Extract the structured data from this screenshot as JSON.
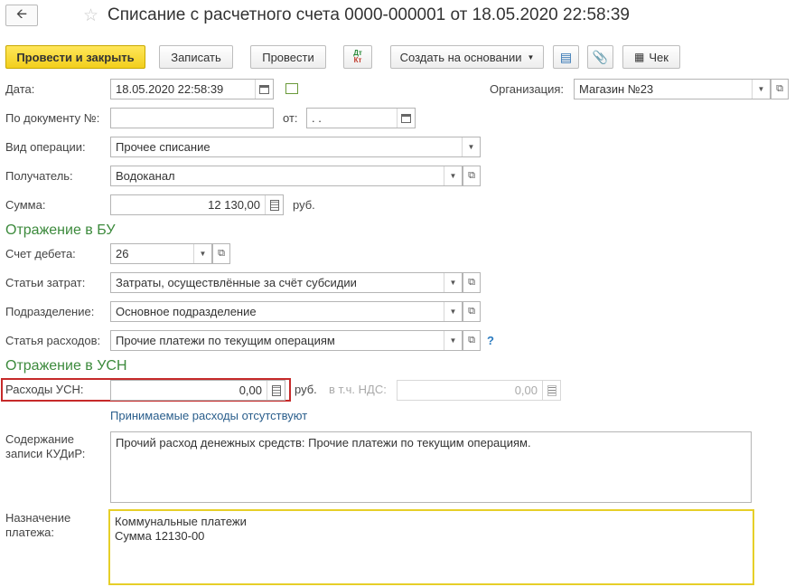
{
  "header": {
    "title": "Списание с расчетного счета 0000-000001 от 18.05.2020 22:58:39"
  },
  "toolbar": {
    "post_close": "Провести и закрыть",
    "save": "Записать",
    "post": "Провести",
    "create_based": "Создать на основании",
    "check": "Чек"
  },
  "form": {
    "date_label": "Дата:",
    "date_value": "18.05.2020 22:58:39",
    "org_label": "Организация:",
    "org_value": "Магазин №23",
    "doc_label": "По документу №:",
    "doc_value": "",
    "from_label": "от:",
    "from_value": " .  .",
    "optype_label": "Вид операции:",
    "optype_value": "Прочее списание",
    "recipient_label": "Получатель:",
    "recipient_value": "Водоканал",
    "sum_label": "Сумма:",
    "sum_value": "12 130,00",
    "currency": "руб."
  },
  "bu": {
    "heading": "Отражение в БУ",
    "debit_label": "Счет дебета:",
    "debit_value": "26",
    "cost_items_label": "Статьи затрат:",
    "cost_items_value": "Затраты, осуществлённые за счёт субсидии",
    "division_label": "Подразделение:",
    "division_value": "Основное подразделение",
    "expense_item_label": "Статья расходов:",
    "expense_item_value": "Прочие платежи по текущим операциям",
    "help": "?"
  },
  "usn": {
    "heading": "Отражение в УСН",
    "expenses_label": "Расходы УСН:",
    "expenses_value": "0,00",
    "currency": "руб.",
    "vat_label": "в т.ч. НДС:",
    "vat_value": "0,00",
    "no_expenses_link": "Принимаемые расходы отсутствуют",
    "kudir_label_1": "Содержание",
    "kudir_label_2": "записи КУДиР:",
    "kudir_value": "Прочий расход денежных средств: Прочие платежи по текущим операциям.",
    "purpose_label_1": "Назначение",
    "purpose_label_2": "платежа:",
    "purpose_line_1": "Коммунальные платежи",
    "purpose_line_2": "Сумма 12130-00"
  },
  "colors": {
    "primary_button": "#f2cf1c",
    "section_heading": "#3c8a3c",
    "highlight_border": "#c62a2a",
    "focus_border": "#e6cf28",
    "link": "#2a5e8c"
  }
}
